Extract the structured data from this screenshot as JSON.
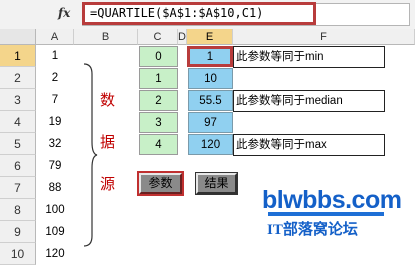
{
  "formula_bar": {
    "fx_label": "fx",
    "formula": "=QUARTILE($A$1:$A$10,C1)"
  },
  "columns": [
    "A",
    "B",
    "C",
    "D",
    "E",
    "F"
  ],
  "rows": [
    "1",
    "2",
    "3",
    "4",
    "5",
    "6",
    "7",
    "8",
    "9",
    "10"
  ],
  "column_a": [
    "1",
    "2",
    "7",
    "19",
    "32",
    "79",
    "88",
    "100",
    "109",
    "120"
  ],
  "brace_chars": [
    "数",
    "据",
    "源"
  ],
  "column_c": [
    "0",
    "1",
    "2",
    "3",
    "4"
  ],
  "column_e": [
    "1",
    "10",
    "55.5",
    "97",
    "120"
  ],
  "column_f": {
    "row1": "此参数等同于min",
    "row3": "此参数等同于median",
    "row5": "此参数等同于max"
  },
  "buttons": {
    "params": "参数",
    "result": "结果"
  },
  "watermark": {
    "site": "blwbbs.com",
    "subtitle": "IT部落窝论坛"
  },
  "colors": {
    "highlight_border": "#b83c3c",
    "green_fill": "#c8f0c8",
    "blue_fill": "#90d0f0",
    "selected_header": "#f4d58b"
  }
}
